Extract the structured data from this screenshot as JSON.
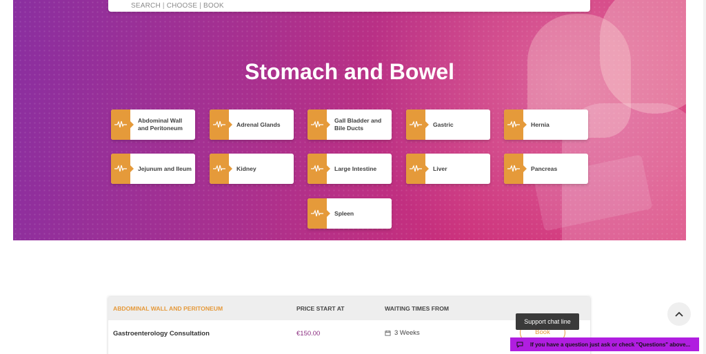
{
  "search_steps": [
    "SEARCH",
    "CHOOSE",
    "BOOK"
  ],
  "hero": {
    "title": "Stomach and Bowel"
  },
  "categories": [
    {
      "label": "Abdominal Wall and Peritoneum"
    },
    {
      "label": "Adrenal Glands"
    },
    {
      "label": "Gall Bladder and Bile Ducts"
    },
    {
      "label": "Gastric"
    },
    {
      "label": "Hernia"
    },
    {
      "label": "Jejunum and Ileum"
    },
    {
      "label": "Kidney"
    },
    {
      "label": "Large Intestine"
    },
    {
      "label": "Liver"
    },
    {
      "label": "Pancreas"
    },
    {
      "label": "Spleen"
    }
  ],
  "table": {
    "headers": [
      "ABDOMINAL WALL AND PERITONEUM",
      "PRICE START AT",
      "WAITING TIMES FROM"
    ],
    "rows": [
      {
        "name": "Gastroenterology Consultation",
        "price": "€150.00",
        "wait": "3 Weeks",
        "action": "Book"
      }
    ]
  },
  "support": {
    "tooltip": "Support chat line",
    "chat_text": "If you have a question just ask or check \"Questions\" above..."
  },
  "colors": {
    "accent": "#e59a3a",
    "hero_start": "#8a2fa0",
    "hero_end": "#d83777",
    "price": "#8a2c7f",
    "chat": "#b01ee0"
  },
  "icons": {
    "category": "heartbeat-icon",
    "calendar": "calendar-icon",
    "to_top": "chevron-up-icon",
    "chat": "chat-bubble-icon"
  }
}
